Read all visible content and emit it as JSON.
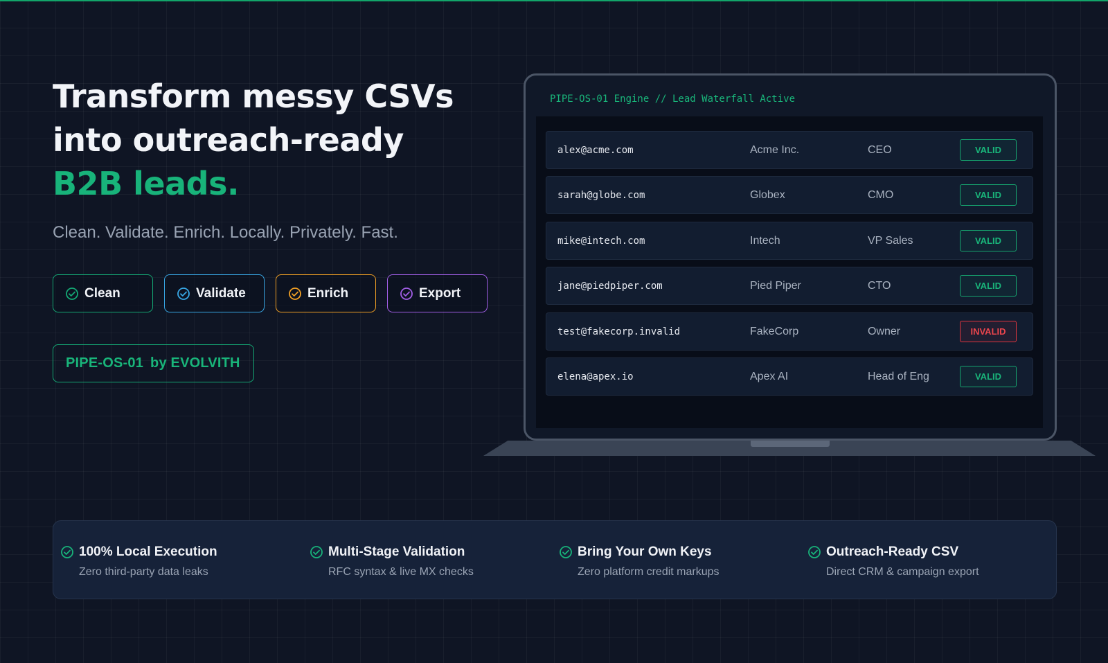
{
  "hero": {
    "title_line1": "Transform messy CSVs",
    "title_line2": "into outreach-ready",
    "title_accent": "B2B leads.",
    "tagline": "Clean. Validate. Enrich. Locally. Privately. Fast."
  },
  "pills": [
    {
      "label": "Clean",
      "color": "#14a874",
      "icon": "check-circle-icon"
    },
    {
      "label": "Validate",
      "color": "#38a8e6",
      "icon": "check-circle-icon"
    },
    {
      "label": "Enrich",
      "color": "#f2a024",
      "icon": "check-circle-icon"
    },
    {
      "label": "Export",
      "color": "#a35fe8",
      "icon": "check-circle-icon"
    }
  ],
  "brand": {
    "name": "PIPE-OS-01",
    "by": "by EVOLVITH"
  },
  "engine": {
    "title": "PIPE-OS-01 Engine // Lead Waterfall Active",
    "rows": [
      {
        "email": "alex@acme.com",
        "company": "Acme Inc.",
        "role": "CEO",
        "status": "VALID"
      },
      {
        "email": "sarah@globe.com",
        "company": "Globex",
        "role": "CMO",
        "status": "VALID"
      },
      {
        "email": "mike@intech.com",
        "company": "Intech",
        "role": "VP Sales",
        "status": "VALID"
      },
      {
        "email": "jane@piedpiper.com",
        "company": "Pied Piper",
        "role": "CTO",
        "status": "VALID"
      },
      {
        "email": "test@fakecorp.invalid",
        "company": "FakeCorp",
        "role": "Owner",
        "status": "INVALID"
      },
      {
        "email": "elena@apex.io",
        "company": "Apex AI",
        "role": "Head of Eng",
        "status": "VALID"
      }
    ]
  },
  "features": [
    {
      "title": "100% Local Execution",
      "sub": "Zero third-party data leaks"
    },
    {
      "title": "Multi-Stage Validation",
      "sub": "RFC syntax & live MX checks"
    },
    {
      "title": "Bring Your Own Keys",
      "sub": "Zero platform credit markups"
    },
    {
      "title": "Outreach-Ready CSV",
      "sub": "Direct CRM & campaign export"
    }
  ],
  "colors": {
    "accent": "#18b37a",
    "valid": "#19b57a",
    "invalid": "#ec454d"
  }
}
